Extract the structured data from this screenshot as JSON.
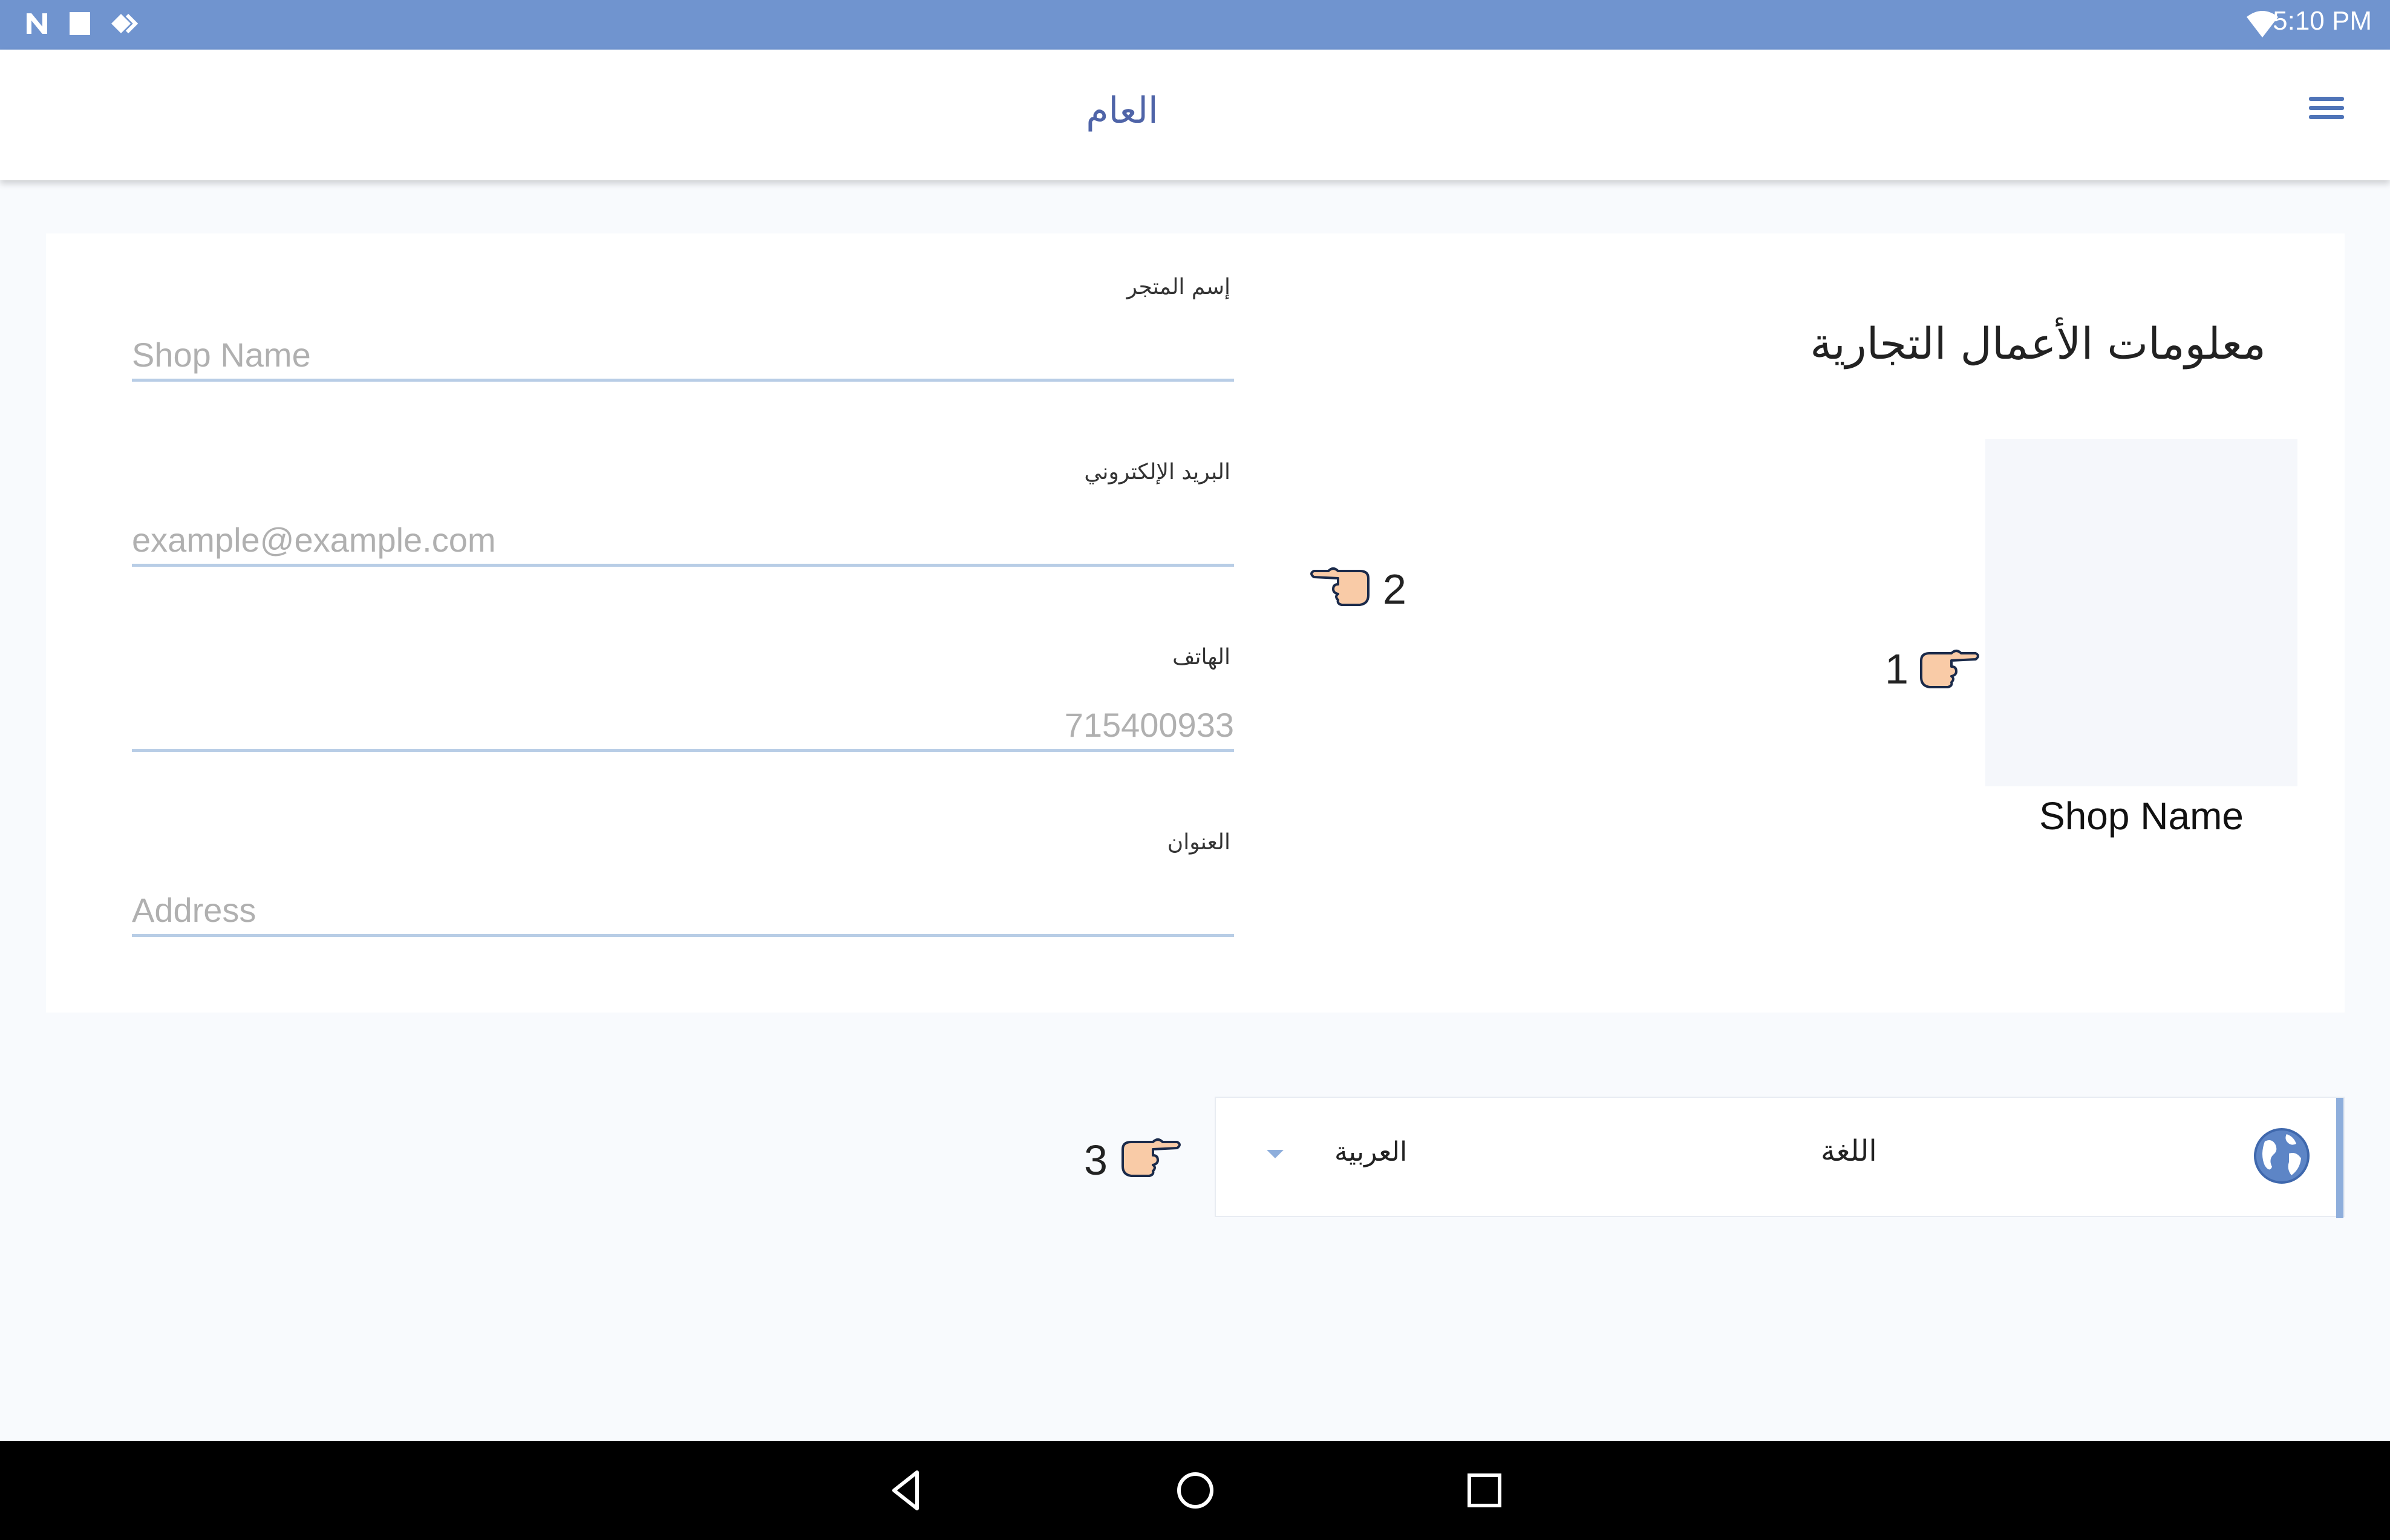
{
  "status_bar": {
    "time": "5:10 PM"
  },
  "app_bar": {
    "title": "العام"
  },
  "business_info": {
    "title": "معلومات الأعمال التجارية",
    "shop_display_name": "Shop Name"
  },
  "form": {
    "shop_name": {
      "label": "إسم المتجر",
      "placeholder": "Shop Name"
    },
    "email": {
      "label": "البريد الإلكتروني",
      "placeholder": "example@example.com"
    },
    "phone": {
      "label": "الهاتف",
      "placeholder": "715400933"
    },
    "address": {
      "label": "العنوان",
      "placeholder": "Address"
    }
  },
  "language": {
    "label": "اللغة",
    "selected": "العربية"
  },
  "annotations": {
    "one": "1",
    "two": "2",
    "three": "3"
  },
  "colors": {
    "status_bar": "#7094cf",
    "accent": "#8eaedc",
    "title": "#4f64a8"
  }
}
